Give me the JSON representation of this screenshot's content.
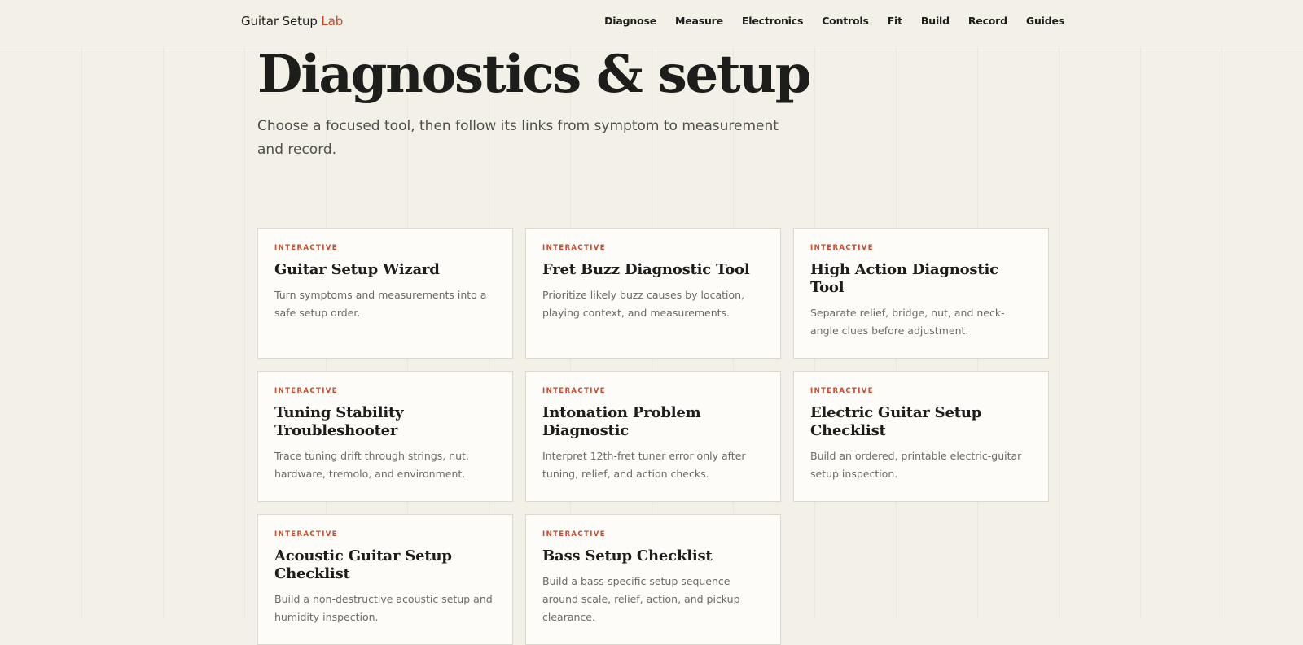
{
  "header": {
    "brand_main": "Guitar Setup",
    "brand_accent": "Lab",
    "nav": [
      "Diagnose",
      "Measure",
      "Electronics",
      "Controls",
      "Fit",
      "Build",
      "Record",
      "Guides"
    ]
  },
  "main": {
    "title": "Diagnostics & setup",
    "intro": "Choose a focused tool, then follow its links from symptom to measurement and record.",
    "cards": [
      {
        "tag": "INTERACTIVE",
        "title": "Guitar Setup Wizard",
        "desc": "Turn symptoms and measurements into a safe setup order."
      },
      {
        "tag": "INTERACTIVE",
        "title": "Fret Buzz Diagnostic Tool",
        "desc": "Prioritize likely buzz causes by location, playing context, and measurements."
      },
      {
        "tag": "INTERACTIVE",
        "title": "High Action Diagnostic Tool",
        "desc": "Separate relief, bridge, nut, and neck-angle clues before adjustment."
      },
      {
        "tag": "INTERACTIVE",
        "title": "Tuning Stability Troubleshooter",
        "desc": "Trace tuning drift through strings, nut, hardware, tremolo, and environment."
      },
      {
        "tag": "INTERACTIVE",
        "title": "Intonation Problem Diagnostic",
        "desc": "Interpret 12th-fret tuner error only after tuning, relief, and action checks."
      },
      {
        "tag": "INTERACTIVE",
        "title": "Electric Guitar Setup Checklist",
        "desc": "Build an ordered, printable electric-guitar setup inspection."
      },
      {
        "tag": "INTERACTIVE",
        "title": "Acoustic Guitar Setup Checklist",
        "desc": "Build a non-destructive acoustic setup and humidity inspection."
      },
      {
        "tag": "INTERACTIVE",
        "title": "Bass Setup Checklist",
        "desc": "Build a bass-specific setup sequence around scale, relief, action, and pickup clearance."
      }
    ]
  }
}
